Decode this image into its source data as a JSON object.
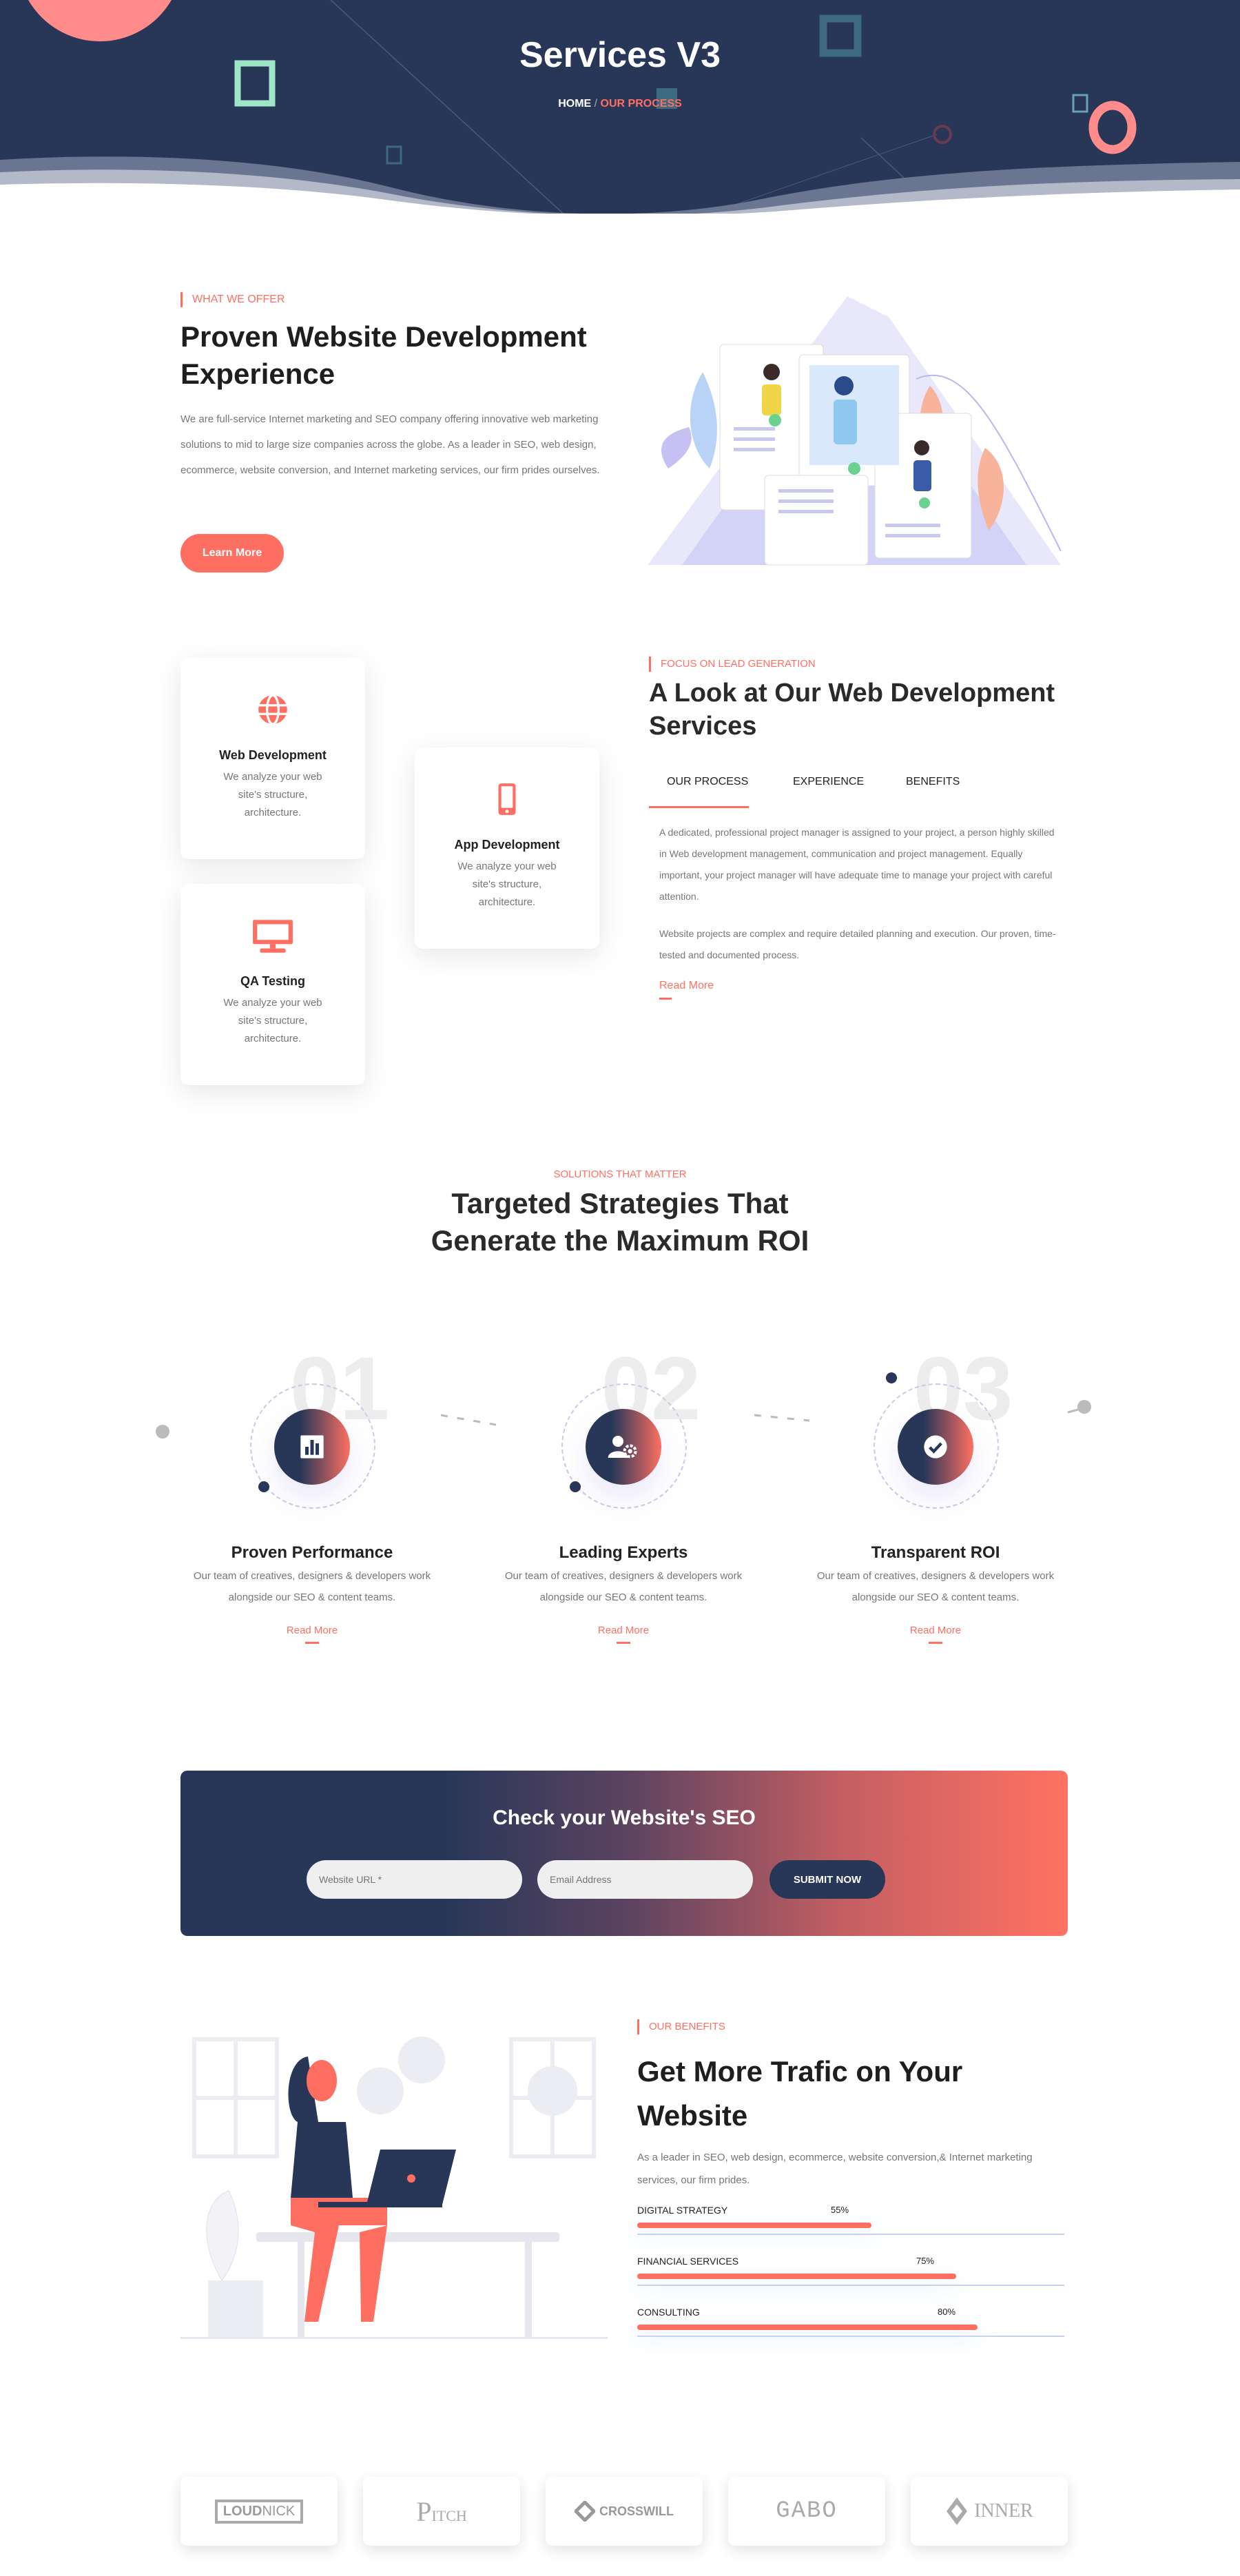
{
  "colors": {
    "primary": "#283758",
    "accent": "#ff6f61"
  },
  "hero": {
    "title": "Services V3",
    "breadcrumb": {
      "home": "HOME",
      "separator": "/",
      "current": "OUR PROCESS"
    }
  },
  "offer": {
    "eyebrow": "WHAT WE OFFER",
    "title": "Proven Website Development Experience",
    "text": "We are full-service Internet marketing and SEO company offering innovative web marketing solutions to mid to large size companies across the globe. As a leader in SEO, web design, ecommerce, website conversion, and Internet marketing services, our firm prides ourselves.",
    "button": "Learn More"
  },
  "services": {
    "cards": [
      {
        "icon": "globe-icon",
        "title": "Web Development",
        "text": "We analyze your web site's structure, architecture."
      },
      {
        "icon": "mobile-icon",
        "title": "App Development",
        "text": "We analyze your web site's structure, architecture."
      },
      {
        "icon": "monitor-icon",
        "title": "QA Testing",
        "text": "We analyze your web site's structure, architecture."
      }
    ],
    "eyebrow": "FOCUS ON LEAD GENERATION",
    "title": "A Look at Our Web Development Services",
    "tabs": [
      {
        "label": "OUR PROCESS",
        "active": true
      },
      {
        "label": "EXPERIENCE"
      },
      {
        "label": "BENEFITS"
      }
    ],
    "paragraphs": [
      "A dedicated, professional project manager is assigned to your project, a person highly skilled in Web development management, communication and project management. Equally important, your project manager will have adequate time to manage your project with careful attention.",
      "Website projects are complex and require detailed planning and execution. Our proven, time-tested and documented process."
    ],
    "read_more": "Read More"
  },
  "strategies": {
    "eyebrow": "SOLUTIONS THAT MATTER",
    "title": "Targeted Strategies That Generate the Maximum ROI",
    "steps": [
      {
        "number": "01",
        "icon": "bar-chart-icon",
        "title": "Proven Performance",
        "text": "Our team of creatives, designers & developers work alongside our SEO & content teams.",
        "link": "Read More"
      },
      {
        "number": "02",
        "icon": "user-gear-icon",
        "title": "Leading Experts",
        "text": "Our team of creatives, designers & developers work alongside our SEO & content teams.",
        "link": "Read More"
      },
      {
        "number": "03",
        "icon": "check-circle-icon",
        "title": "Transparent ROI",
        "text": "Our team of creatives, designers & developers work alongside our SEO & content teams.",
        "link": "Read More"
      }
    ]
  },
  "seo_check": {
    "title": "Check your Website's SEO",
    "url_placeholder": "Website URL *",
    "email_placeholder": "Email Address",
    "submit": "SUBMIT NOW"
  },
  "benefits": {
    "eyebrow": "OUR BENEFITS",
    "title": "Get More Trafic on Your Website",
    "text": "As a leader in SEO, web design, ecommerce, website conversion,& Internet marketing services, our firm prides.",
    "skills": [
      {
        "label": "DIGITAL STRATEGY",
        "value": 55,
        "display": "55%"
      },
      {
        "label": "FINANCIAL SERVICES",
        "value": 75,
        "display": "75%"
      },
      {
        "label": "CONSULTING",
        "value": 80,
        "display": "80%"
      }
    ]
  },
  "clients": [
    {
      "name": "LOUDNICK"
    },
    {
      "name": "PITCH"
    },
    {
      "name": "CROSSWILL"
    },
    {
      "name": "GABO"
    },
    {
      "name": "INNER"
    }
  ]
}
